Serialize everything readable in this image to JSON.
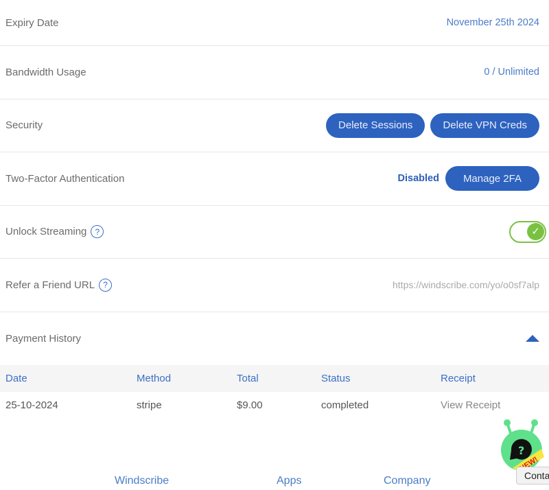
{
  "rows": {
    "expiry": {
      "label": "Expiry Date",
      "value": "November 25th 2024"
    },
    "bandwidth": {
      "label": "Bandwidth Usage",
      "value": "0 / Unlimited"
    },
    "security": {
      "label": "Security",
      "delete_sessions": "Delete Sessions",
      "delete_vpn": "Delete VPN Creds"
    },
    "twofa": {
      "label": "Two-Factor Authentication",
      "status": "Disabled",
      "manage": "Manage 2FA"
    },
    "streaming": {
      "label": "Unlock Streaming",
      "enabled": true
    },
    "refer": {
      "label": "Refer a Friend URL",
      "url": "https://windscribe.com/yo/o0sf7alp"
    },
    "payment": {
      "label": "Payment History"
    }
  },
  "table": {
    "headers": [
      "Date",
      "Method",
      "Total",
      "Status",
      "Receipt"
    ],
    "rows": [
      [
        "25-10-2024",
        "stripe",
        "$9.00",
        "completed",
        "View Receipt"
      ]
    ]
  },
  "footer": {
    "links": [
      "Windscribe",
      "Apps",
      "Company"
    ]
  },
  "chat": {
    "badge": "NEW!",
    "contact": "Contact"
  },
  "colors": {
    "accent": "#2d62bf",
    "toggle": "#7ac143"
  }
}
